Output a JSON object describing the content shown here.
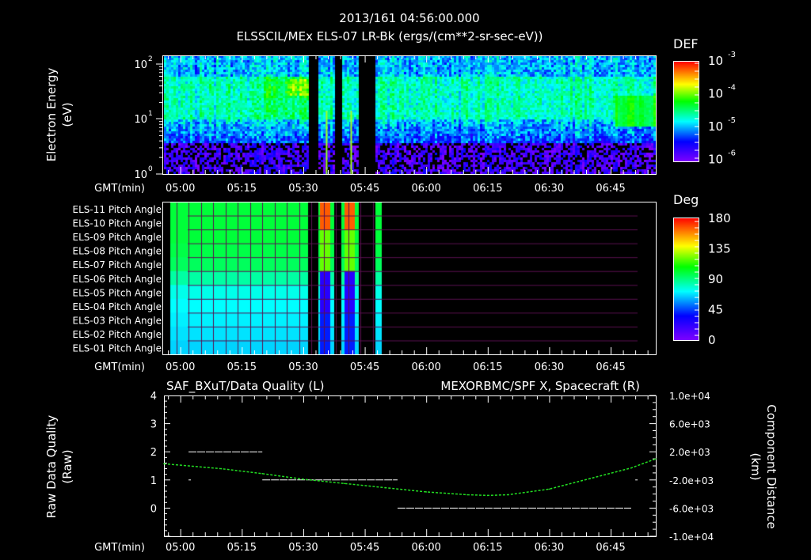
{
  "header": {
    "timestamp": "2013/161 04:56:00.000",
    "title": "ELSSCIL/MEx ELS-07 LR-Bk  (ergs/(cm**2-sr-sec-eV))"
  },
  "colors": {
    "background": "#000000",
    "axis": "#ffffff",
    "grid": "#5a1050",
    "orbit_line": "#22dd22"
  },
  "chart_data": [
    {
      "type": "heatmap",
      "name": "electron-energy-spectrogram",
      "ylabel": "Electron Energy",
      "yunit": "(eV)",
      "xlabel": "GMT(min)",
      "xlim": [
        "04:56",
        "06:56"
      ],
      "ylim_log10": [
        0,
        2.16
      ],
      "yticks": [
        {
          "base": "10",
          "exp": "2",
          "value": 2
        },
        {
          "base": "10",
          "exp": "1",
          "value": 1
        },
        {
          "base": "10",
          "exp": "0",
          "value": 0
        }
      ],
      "xticks": [
        "05:00",
        "05:15",
        "05:30",
        "05:45",
        "06:00",
        "06:15",
        "06:30",
        "06:45"
      ],
      "colorbar": {
        "title": "DEF",
        "scale": "log",
        "range_log10": [
          -6,
          -3
        ],
        "ticks": [
          {
            "base": "10",
            "exp": "-3"
          },
          {
            "base": "10",
            "exp": "-4"
          },
          {
            "base": "10",
            "exp": "-5"
          },
          {
            "base": "10",
            "exp": "-6"
          }
        ]
      },
      "data_gaps_min": [
        [
          331,
          333.5
        ],
        [
          337.5,
          339.2
        ],
        [
          343.5,
          347.5
        ]
      ],
      "spikes_min": [
        335.5,
        341.5
      ]
    },
    {
      "type": "heatmap",
      "name": "pitch-angle",
      "xlabel": "GMT(min)",
      "xlim": [
        "04:56",
        "06:56"
      ],
      "xticks": [
        "05:00",
        "05:15",
        "05:30",
        "05:45",
        "06:00",
        "06:15",
        "06:30",
        "06:45"
      ],
      "rows": [
        "ELS-11 Pitch Angle",
        "ELS-10 Pitch Angle",
        "ELS-09 Pitch Angle",
        "ELS-08 Pitch Angle",
        "ELS-07 Pitch Angle",
        "ELS-06 Pitch Angle",
        "ELS-05 Pitch Angle",
        "ELS-04 Pitch Angle",
        "ELS-03 Pitch Angle",
        "ELS-02 Pitch Angle",
        "ELS-01 Pitch Angle"
      ],
      "pitch_start_deg": [
        100,
        100,
        100,
        98,
        95,
        85,
        75,
        72,
        70,
        68,
        66
      ],
      "pitch_end_deg": [
        140,
        130,
        115,
        105,
        65,
        40,
        25,
        22,
        25,
        30,
        45
      ],
      "data_range_min": [
        297.5,
        349
      ],
      "data_gaps_min": [
        [
          331,
          333.5
        ],
        [
          337.5,
          339.2
        ],
        [
          343.5,
          347.5
        ]
      ],
      "colorbar": {
        "title": "Deg",
        "range": [
          0,
          180
        ],
        "ticks": [
          "180",
          "135",
          "90",
          "45",
          "0"
        ]
      }
    },
    {
      "type": "line",
      "name": "data-quality-and-position",
      "title_left": "SAF_BXuT/Data Quality (L)",
      "title_right": "MEXORBMC/SPF X, Spacecraft (R)",
      "ylabel_left": "Raw Data Quality",
      "ylabel_left_unit": "(Raw)",
      "ylabel_right": "Component Distance",
      "ylabel_right_unit": "(km)",
      "xlabel": "GMT(min)",
      "xlim": [
        "04:56",
        "06:56"
      ],
      "ylim_left": [
        -1,
        4
      ],
      "ylim_right": [
        -10000,
        10000
      ],
      "yticks_left": [
        "4",
        "3",
        "2",
        "1",
        "0"
      ],
      "yticks_right": [
        "1.0e+04",
        "6.0e+03",
        "2.0e+03",
        "-2.0e+03",
        "-6.0e+03",
        "-1.0e+04"
      ],
      "xticks": [
        "05:00",
        "05:15",
        "05:30",
        "05:45",
        "06:00",
        "06:15",
        "06:30",
        "06:45"
      ],
      "series": [
        {
          "name": "Data Quality",
          "axis": "left",
          "segments": [
            {
              "x": [
                "05:02",
                "05:20"
              ],
              "y": 2
            },
            {
              "x": [
                "05:20",
                "05:53"
              ],
              "y": 1
            },
            {
              "x": [
                "05:53",
                "06:50"
              ],
              "y": 0
            },
            {
              "x": [
                "05:02",
                "05:02"
              ],
              "y": 1
            },
            {
              "x": [
                "06:51",
                "06:51"
              ],
              "y": 1
            }
          ]
        },
        {
          "name": "SPF X",
          "axis": "right",
          "x": [
            "04:56",
            "05:10",
            "05:20",
            "05:30",
            "05:40",
            "05:50",
            "06:00",
            "06:10",
            "06:15",
            "06:20",
            "06:30",
            "06:40",
            "06:50",
            "06:56"
          ],
          "y": [
            300,
            -400,
            -1100,
            -1900,
            -2500,
            -3100,
            -3700,
            -4100,
            -4200,
            -4100,
            -3300,
            -1800,
            -300,
            1000
          ]
        }
      ]
    }
  ]
}
